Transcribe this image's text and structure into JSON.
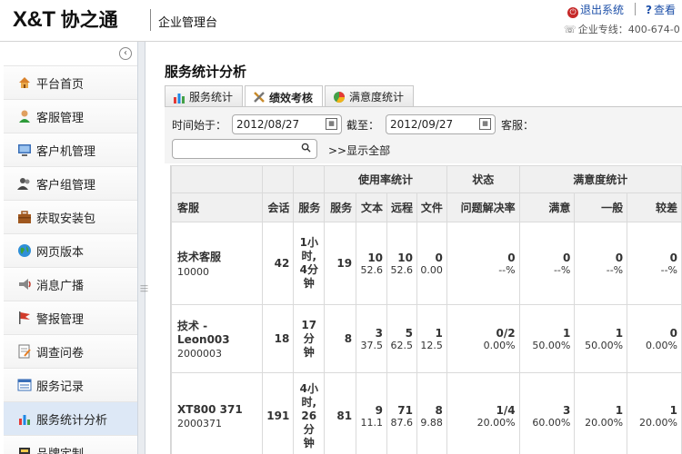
{
  "header": {
    "logo_text": "X&T",
    "logo_cn": "协之通",
    "platform": "企业管理台",
    "logout": "退出系统",
    "help": "查看",
    "hotline": "企业专线：400-674-0"
  },
  "sidebar": {
    "collapse": "‹",
    "items": [
      {
        "label": "平台首页",
        "icon": "home-icon"
      },
      {
        "label": "客服管理",
        "icon": "user-icon"
      },
      {
        "label": "客户机管理",
        "icon": "monitor-icon"
      },
      {
        "label": "客户组管理",
        "icon": "group-icon"
      },
      {
        "label": "获取安装包",
        "icon": "package-icon"
      },
      {
        "label": "网页版本",
        "icon": "globe-icon"
      },
      {
        "label": "消息广播",
        "icon": "broadcast-icon"
      },
      {
        "label": "警报管理",
        "icon": "flag-icon"
      },
      {
        "label": "调查问卷",
        "icon": "survey-icon"
      },
      {
        "label": "服务记录",
        "icon": "list-icon"
      },
      {
        "label": "服务统计分析",
        "icon": "chart-icon"
      },
      {
        "label": "品牌定制",
        "icon": "brand-icon"
      }
    ]
  },
  "main": {
    "title": "服务统计分析",
    "tabs": [
      {
        "label": "服务统计",
        "icon": "bar-chart-icon"
      },
      {
        "label": "绩效考核",
        "icon": "tools-icon"
      },
      {
        "label": "满意度统计",
        "icon": "pie-chart-icon"
      }
    ],
    "filter": {
      "start_label": "时间始于：",
      "start_value": "2012/08/27",
      "end_label": "截至：",
      "end_value": "2012/09/27",
      "agent_label": "客服：",
      "search_placeholder": "",
      "show_all": ">>显示全部"
    }
  },
  "table": {
    "group_headers": {
      "usage": "使用率统计",
      "status": "状态",
      "satisfaction": "满意度统计"
    },
    "columns": [
      "客服",
      "会话",
      "服务",
      "服务",
      "文本",
      "远程",
      "文件",
      "问题解决率",
      "满意",
      "一般",
      "较差"
    ],
    "rows": [
      {
        "name": "技术客服",
        "id": "10000",
        "sessions": "42",
        "duration": [
          "1小",
          "时,",
          "4分",
          "钟"
        ],
        "service": "19",
        "text": {
          "count": "10",
          "pct": "52.6"
        },
        "remote": {
          "count": "10",
          "pct": "52.6"
        },
        "file": {
          "count": "0",
          "pct": "0.00"
        },
        "resolve": {
          "count": "0",
          "pct": "--%"
        },
        "good": {
          "count": "0",
          "pct": "--%"
        },
        "normal": {
          "count": "0",
          "pct": "--%"
        },
        "poor": {
          "count": "0",
          "pct": "--%"
        }
      },
      {
        "name": "技术 -",
        "name2": "Leon003",
        "id": "2000003",
        "sessions": "18",
        "duration": [
          "17",
          "分",
          "钟"
        ],
        "service": "8",
        "text": {
          "count": "3",
          "pct": "37.5"
        },
        "remote": {
          "count": "5",
          "pct": "62.5"
        },
        "file": {
          "count": "1",
          "pct": "12.5"
        },
        "resolve": {
          "count": "0/2",
          "pct": "0.00%"
        },
        "good": {
          "count": "1",
          "pct": "50.00%"
        },
        "normal": {
          "count": "1",
          "pct": "50.00%"
        },
        "poor": {
          "count": "0",
          "pct": "0.00%"
        }
      },
      {
        "name": "XT800 371",
        "id": "2000371",
        "sessions": "191",
        "duration": [
          "4小",
          "时,",
          "26",
          "分",
          "钟"
        ],
        "service": "81",
        "text": {
          "count": "9",
          "pct": "11.1"
        },
        "remote": {
          "count": "71",
          "pct": "87.6"
        },
        "file": {
          "count": "8",
          "pct": "9.88"
        },
        "resolve": {
          "count": "1/4",
          "pct": "20.00%"
        },
        "good": {
          "count": "3",
          "pct": "60.00%"
        },
        "normal": {
          "count": "1",
          "pct": "20.00%"
        },
        "poor": {
          "count": "1",
          "pct": "20.00%"
        }
      }
    ]
  },
  "colors": {
    "active_menu": "#dde8f6",
    "link": "#1c4fa8",
    "logout_icon": "#c62828"
  }
}
